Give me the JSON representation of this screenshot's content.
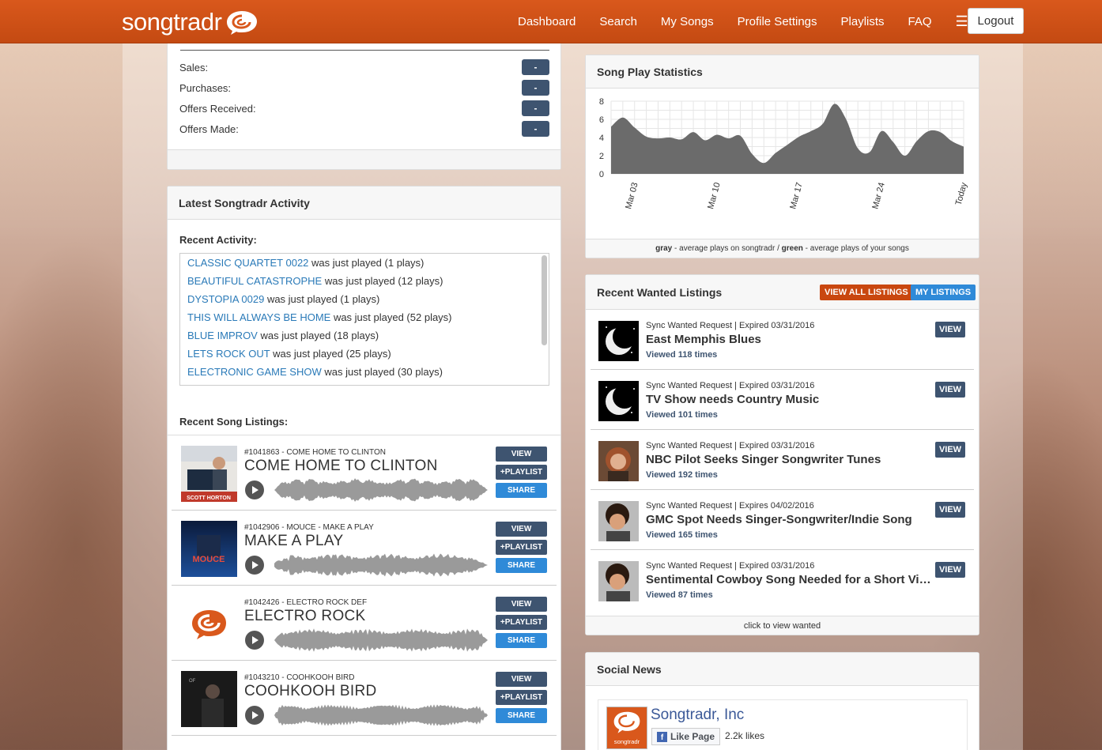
{
  "nav": {
    "brand": "songtradr",
    "links": [
      "Dashboard",
      "Search",
      "My Songs",
      "Profile Settings",
      "Playlists",
      "FAQ"
    ],
    "menu_icon": "hamburger-icon",
    "logout_label": "Logout"
  },
  "stats": {
    "rows": [
      {
        "label": "Sales:",
        "value": "-"
      },
      {
        "label": "Purchases:",
        "value": "-"
      },
      {
        "label": "Offers Received:",
        "value": "-"
      },
      {
        "label": "Offers Made:",
        "value": "-"
      }
    ]
  },
  "activity": {
    "title": "Latest Songtradr Activity",
    "recent_label": "Recent Activity:",
    "items": [
      {
        "song": "CLASSIC QUARTET 0022",
        "text": " was just played (1 plays)"
      },
      {
        "song": "BEAUTIFUL CATASTROPHE",
        "text": " was just played (12 plays)"
      },
      {
        "song": "DYSTOPIA 0029",
        "text": " was just played (1 plays)"
      },
      {
        "song": "THIS WILL ALWAYS BE HOME",
        "text": " was just played (52 plays)"
      },
      {
        "song": "BLUE IMPROV",
        "text": " was just played (18 plays)"
      },
      {
        "song": "LETS ROCK OUT",
        "text": " was just played (25 plays)"
      },
      {
        "song": "ELECTRONIC GAME SHOW",
        "text": " was just played (30 plays)"
      }
    ],
    "listings_label": "Recent Song Listings:",
    "listings": [
      {
        "id": "#1041863 - COME HOME TO CLINTON",
        "title": "COME HOME TO CLINTON",
        "cover_caption": "SCOTT HORTON"
      },
      {
        "id": "#1042906 - MOUCE - MAKE A PLAY",
        "title": "MAKE A PLAY",
        "cover_caption": "MOUCE"
      },
      {
        "id": "#1042426 - ELECTRO ROCK DEF",
        "title": "ELECTRO ROCK",
        "cover_caption": ""
      },
      {
        "id": "#1043210 - COOHKOOH BIRD",
        "title": "COOHKOOH BIRD",
        "cover_caption": ""
      }
    ],
    "buttons": {
      "view": "VIEW",
      "playlist": "+PLAYLIST",
      "share": "SHARE"
    }
  },
  "chart_panel": {
    "title": "Song Play Statistics",
    "footer_gray": "gray",
    "footer_mid": " - average plays on songtradr / ",
    "footer_green": "green",
    "footer_end": " - average plays of your songs"
  },
  "chart_data": {
    "type": "area",
    "title": "Song Play Statistics",
    "xlabel": "",
    "ylabel": "",
    "ylim": [
      0,
      8
    ],
    "yticks": [
      0,
      2,
      4,
      6,
      8
    ],
    "xtick_labels": [
      "Mar 03",
      "Mar 10",
      "Mar 17",
      "Mar 24",
      "Today"
    ],
    "grid": true,
    "series": [
      {
        "name": "average plays on songtradr",
        "color": "#6b6b6b",
        "x": [
          0,
          1,
          2,
          3,
          4,
          5,
          6,
          7,
          8,
          9,
          10,
          11,
          12,
          13,
          14,
          15,
          16,
          17,
          18,
          19,
          20,
          21,
          22,
          23,
          24,
          25,
          26,
          27,
          28,
          29,
          30
        ],
        "values": [
          5.2,
          6.2,
          5.1,
          4.1,
          3.9,
          4.0,
          3.8,
          4.6,
          3.7,
          4.3,
          3.9,
          4.2,
          2.2,
          1.2,
          2.3,
          3.2,
          4.1,
          4.7,
          5.5,
          7.7,
          6.0,
          2.8,
          2.4,
          4.7,
          3.5,
          2.0,
          3.6,
          4.7,
          4.6,
          3.6,
          3.0
        ]
      },
      {
        "name": "average plays of your songs",
        "color": "#5cb85c",
        "values": []
      }
    ]
  },
  "wanted": {
    "title": "Recent Wanted Listings",
    "view_all_label": "VIEW ALL LISTINGS",
    "my_listings_label": "MY LISTINGS",
    "view_label": "VIEW",
    "items": [
      {
        "meta": "Sync Wanted Request | Expired 03/31/2016",
        "title": "East Memphis Blues",
        "views": "Viewed 118 times",
        "thumb": "moon"
      },
      {
        "meta": "Sync Wanted Request | Expired 03/31/2016",
        "title": "TV Show needs Country Music",
        "views": "Viewed 101 times",
        "thumb": "moon"
      },
      {
        "meta": "Sync Wanted Request | Expired 03/31/2016",
        "title": "NBC Pilot Seeks Singer Songwriter Tunes",
        "views": "Viewed 192 times",
        "thumb": "woman"
      },
      {
        "meta": "Sync Wanted Request | Expires 04/02/2016",
        "title": "GMC Spot Needs Singer-Songwriter/Indie Song",
        "views": "Viewed 165 times",
        "thumb": "man"
      },
      {
        "meta": "Sync Wanted Request | Expired 03/31/2016",
        "title": "Sentimental Cowboy Song Needed for a Short Video",
        "views": "Viewed 87 times",
        "thumb": "man"
      }
    ],
    "footer": "click to view wanted"
  },
  "social": {
    "title": "Social News",
    "page_name": "Songtradr, Inc",
    "like_label": "Like Page",
    "likes": "2.2k likes",
    "logo_caption": "songtradr"
  },
  "colors": {
    "brand": "#d9581c",
    "button_dark": "#3e5470",
    "button_blue": "#2f8ad8",
    "link": "#2a7ab8"
  }
}
